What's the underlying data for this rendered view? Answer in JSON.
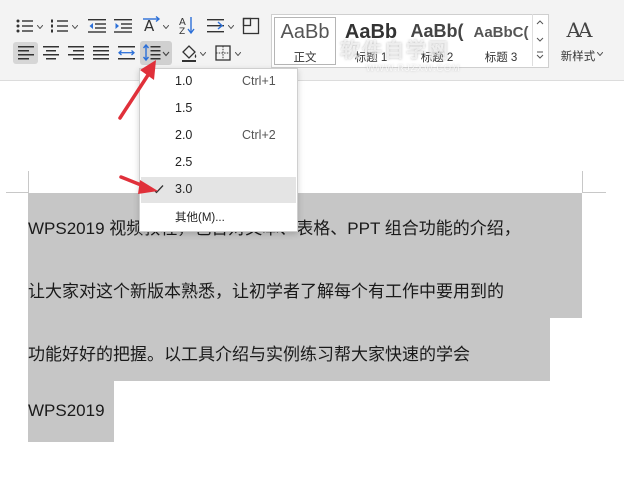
{
  "ribbon": {
    "styles": [
      {
        "sample": "AaBb",
        "name": "正文",
        "selected": true
      },
      {
        "sample": "AaBb",
        "name": "标题 1",
        "selected": false
      },
      {
        "sample": "AaBb(",
        "name": "标题 2",
        "selected": false
      },
      {
        "sample": "AaBbC(",
        "name": "标题 3",
        "selected": false
      }
    ],
    "new_style_label": "新样式",
    "new_style_icon_text": "AA",
    "watermark": "软件自学网",
    "watermark_sub": "WWW.RJZXW.COM"
  },
  "line_spacing_menu": {
    "items": [
      {
        "label": "1.0",
        "shortcut": "Ctrl+1",
        "checked": false
      },
      {
        "label": "1.5",
        "shortcut": "",
        "checked": false
      },
      {
        "label": "2.0",
        "shortcut": "Ctrl+2",
        "checked": false
      },
      {
        "label": "2.5",
        "shortcut": "",
        "checked": false
      },
      {
        "label": "3.0",
        "shortcut": "",
        "checked": true
      }
    ],
    "other_label": "其他(M)..."
  },
  "document": {
    "lines": [
      "WPS2019 视频教程，包含对文本、表格、PPT 组合功能的介绍，",
      "让大家对这个新版本熟悉，让初学者了解每个有工作中要用到的",
      "功能好好的把握。以工具介绍与实例练习帮大家快速的学会",
      "WPS2019"
    ]
  },
  "colors": {
    "selection": "#c6c6c6",
    "arrow": "#e0303a",
    "ribbon_bg": "#f3f3f3"
  }
}
